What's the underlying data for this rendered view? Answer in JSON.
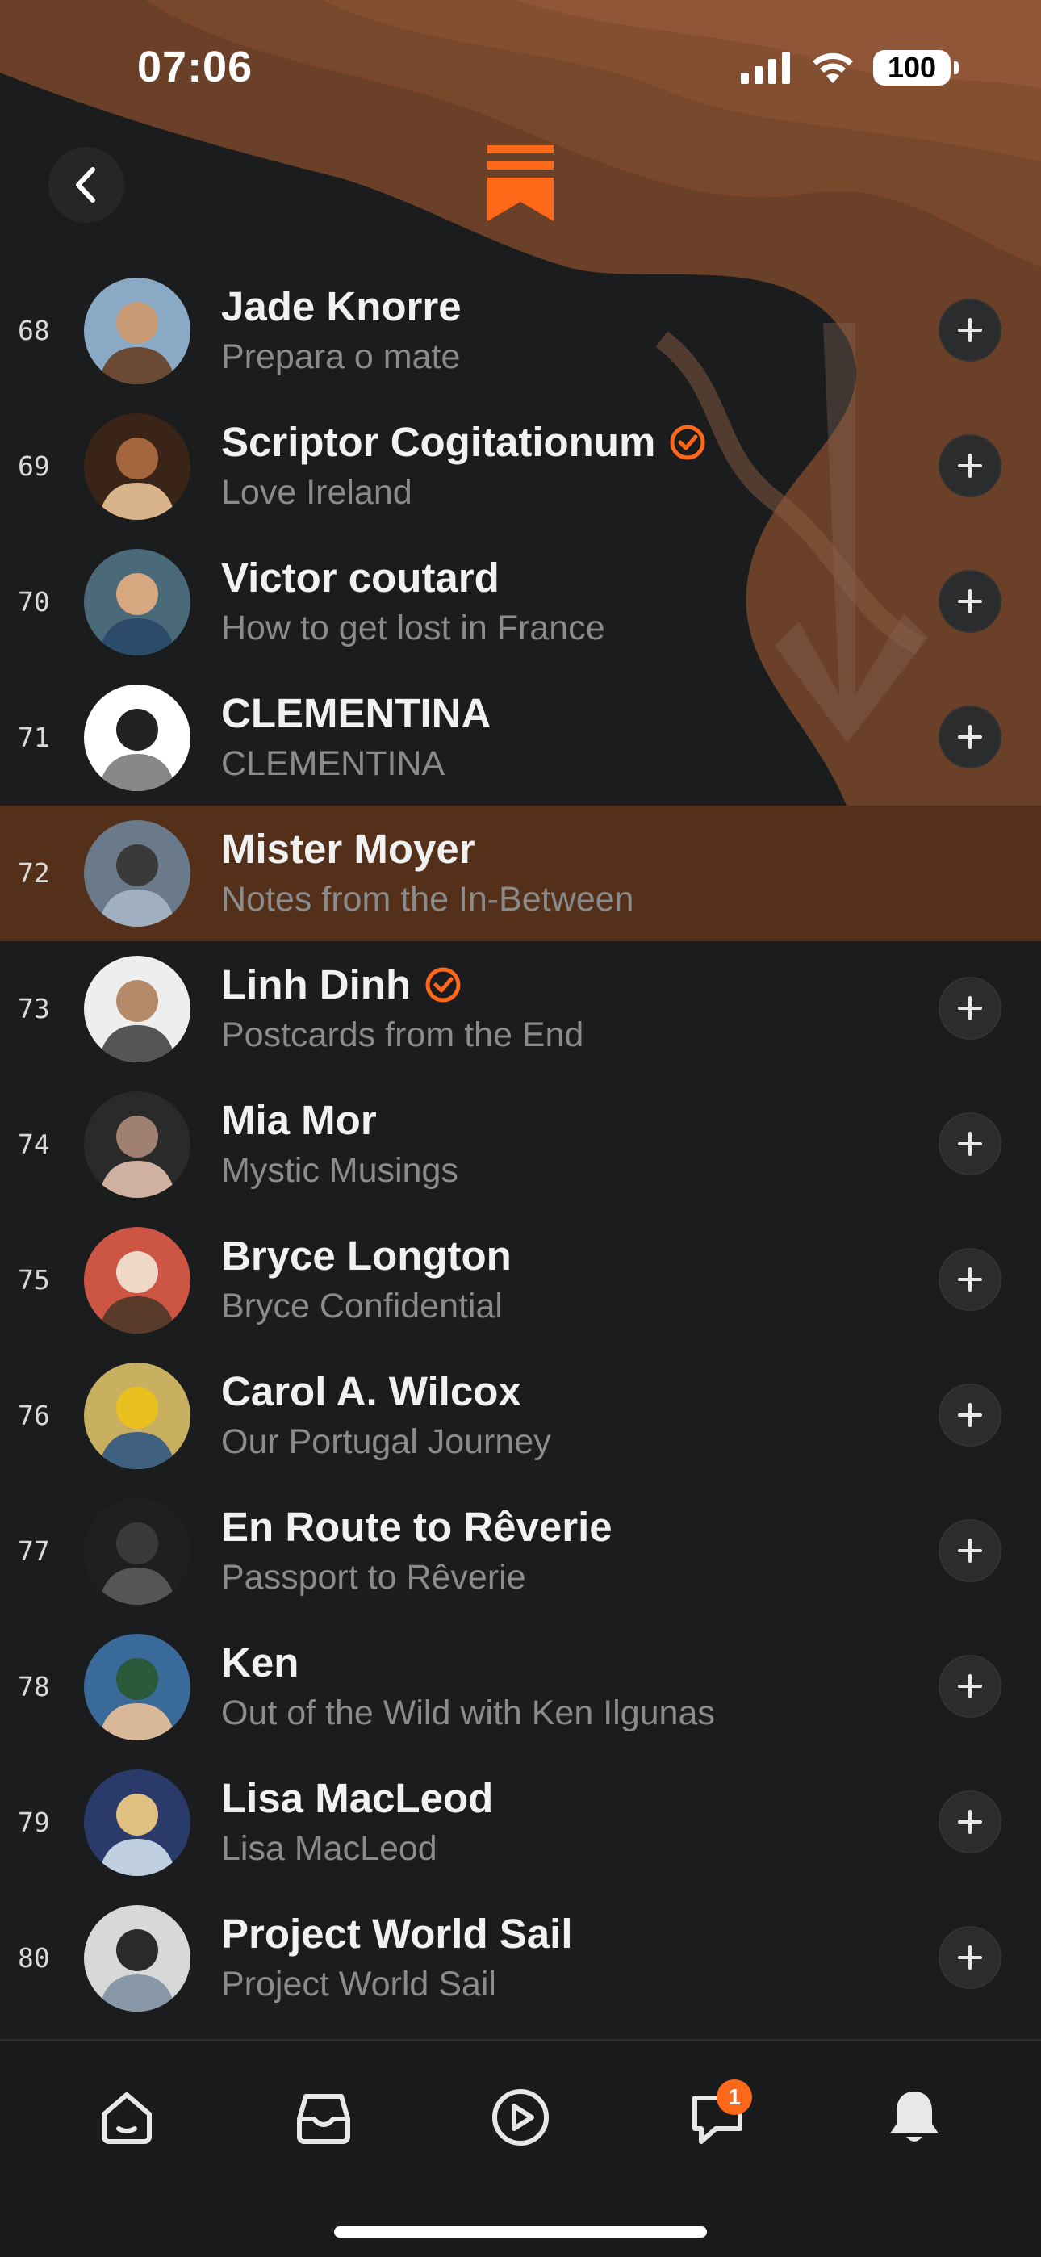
{
  "status": {
    "time": "07:06",
    "battery": "100"
  },
  "header": {
    "back_icon": "chevron-left-icon",
    "logo": "substack-bookmark-logo",
    "accent": "#ff6719"
  },
  "list": [
    {
      "rank": "68",
      "name": "Jade Knorre",
      "subtitle": "Prepara o mate",
      "verified": false,
      "highlight": false
    },
    {
      "rank": "69",
      "name": "Scriptor Cogitationum",
      "subtitle": "Love Ireland",
      "verified": true,
      "highlight": false
    },
    {
      "rank": "70",
      "name": "Victor coutard",
      "subtitle": "How to get lost in France",
      "verified": false,
      "highlight": false
    },
    {
      "rank": "71",
      "name": "CLEMENTINA",
      "subtitle": "CLEMENTINA",
      "verified": false,
      "highlight": false
    },
    {
      "rank": "72",
      "name": "Mister Moyer",
      "subtitle": "Notes from the In-Between",
      "verified": false,
      "highlight": true
    },
    {
      "rank": "73",
      "name": "Linh Dinh",
      "subtitle": "Postcards from the End",
      "verified": true,
      "highlight": false
    },
    {
      "rank": "74",
      "name": "Mia Mor",
      "subtitle": "Mystic Musings",
      "verified": false,
      "highlight": false
    },
    {
      "rank": "75",
      "name": "Bryce Longton",
      "subtitle": "Bryce Confidential",
      "verified": false,
      "highlight": false
    },
    {
      "rank": "76",
      "name": "Carol A. Wilcox",
      "subtitle": "Our Portugal Journey",
      "verified": false,
      "highlight": false
    },
    {
      "rank": "77",
      "name": "En Route to Rêverie",
      "subtitle": "Passport to Rêverie",
      "verified": false,
      "highlight": false
    },
    {
      "rank": "78",
      "name": "Ken",
      "subtitle": "Out of the Wild with Ken Ilgunas",
      "verified": false,
      "highlight": false
    },
    {
      "rank": "79",
      "name": "Lisa MacLeod",
      "subtitle": "Lisa MacLeod",
      "verified": false,
      "highlight": false
    },
    {
      "rank": "80",
      "name": "Project World Sail",
      "subtitle": "Project World Sail",
      "verified": false,
      "highlight": false
    }
  ],
  "tabbar": {
    "tabs": [
      "home-icon",
      "inbox-icon",
      "play-icon",
      "chat-icon",
      "bell-icon"
    ],
    "chat_badge": "1"
  }
}
